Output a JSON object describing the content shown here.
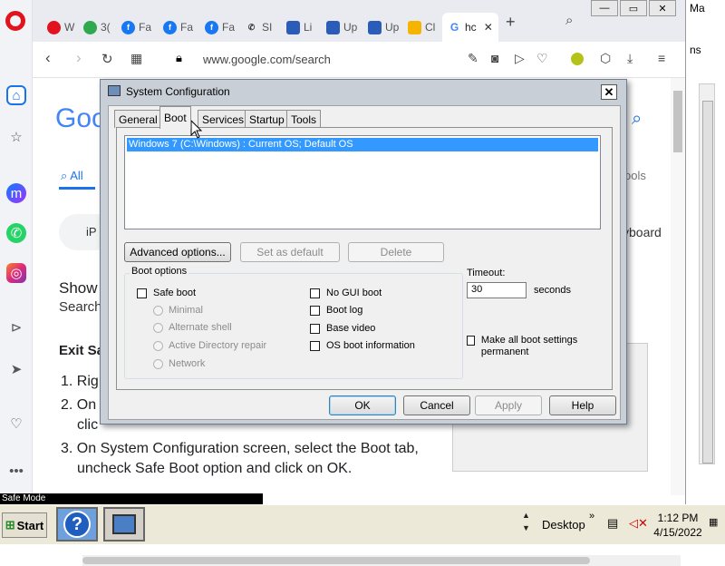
{
  "browser": {
    "tabs": [
      {
        "label": "W",
        "icon": "opera-icon"
      },
      {
        "label": "3(",
        "icon": "browser-icon"
      },
      {
        "label": "Fa",
        "icon": "facebook-icon"
      },
      {
        "label": "Fa",
        "icon": "facebook-icon"
      },
      {
        "label": "Fa",
        "icon": "facebook-icon"
      },
      {
        "label": "SI",
        "icon": "phone-icon"
      },
      {
        "label": "Li",
        "icon": "page-icon"
      },
      {
        "label": "Up",
        "icon": "page-icon"
      },
      {
        "label": "Up",
        "icon": "page-icon"
      },
      {
        "label": "Cl",
        "icon": "page-icon"
      },
      {
        "label": "hc",
        "icon": "google-icon"
      }
    ],
    "url": "www.google.com/search"
  },
  "google": {
    "logo": "Goo",
    "all_tab": "All",
    "tools": "ools",
    "search_fragment": "iP",
    "keyboard": "yboard",
    "show": "Show",
    "search_word": "Search",
    "exit_heading": "Exit Sa",
    "steps": [
      "1.  Rig",
      "2.  On",
      "clic",
      "3.  On System Configuration screen, select the Boot tab,",
      "uncheck Safe Boot option and click on OK."
    ]
  },
  "background_window": {
    "fragments": [
      "Ma",
      "ns"
    ]
  },
  "dialog": {
    "title": "System Configuration",
    "tabs": [
      "General",
      "Boot",
      "Services",
      "Startup",
      "Tools"
    ],
    "active_tab": "Boot",
    "os_entries": [
      "Windows 7 (C:\\Windows) : Current OS; Default OS"
    ],
    "buttons": {
      "advanced": "Advanced options...",
      "set_default": "Set as default",
      "delete": "Delete",
      "ok": "OK",
      "cancel": "Cancel",
      "apply": "Apply",
      "help": "Help"
    },
    "boot_options": {
      "legend": "Boot options",
      "safe_boot": "Safe boot",
      "minimal": "Minimal",
      "alternate_shell": "Alternate shell",
      "ad_repair": "Active Directory repair",
      "network": "Network",
      "no_gui": "No GUI boot",
      "boot_log": "Boot log",
      "base_video": "Base video",
      "os_info": "OS boot information"
    },
    "timeout": {
      "label": "Timeout:",
      "value": "30",
      "unit": "seconds"
    },
    "make_permanent": "Make all boot settings permanent"
  },
  "taskbar": {
    "safe_mode": "Safe Mode",
    "start": "Start",
    "desktop": "Desktop",
    "time": "1:12 PM",
    "date": "4/15/2022"
  }
}
